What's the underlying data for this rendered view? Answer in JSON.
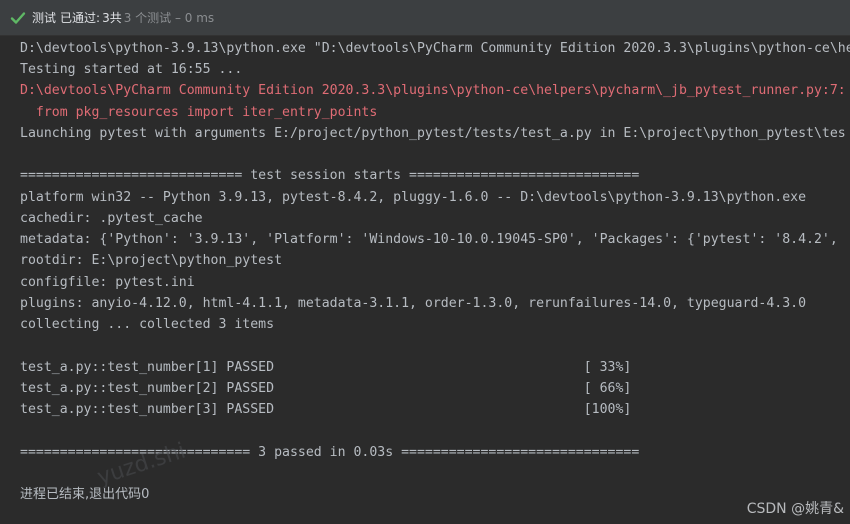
{
  "topbar": {
    "label": "测试",
    "passed_label": "已通过:",
    "count": "3共",
    "total": "3 个测试 – 0 ms",
    "accent": "#5fb865"
  },
  "console": {
    "lines": [
      "D:\\devtools\\python-3.9.13\\python.exe \"D:\\devtools\\PyCharm Community Edition 2020.3.3\\plugins\\python-ce\\he",
      "Testing started at 16:55 ...",
      "D:\\devtools\\PyCharm Community Edition 2020.3.3\\plugins\\python-ce\\helpers\\pycharm\\_jb_pytest_runner.py:7:",
      "  from pkg_resources import iter_entry_points",
      "Launching pytest with arguments E:/project/python_pytest/tests/test_a.py in E:\\project\\python_pytest\\tes",
      "============================ test session starts =============================",
      "platform win32 -- Python 3.9.13, pytest-8.4.2, pluggy-1.6.0 -- D:\\devtools\\python-3.9.13\\python.exe",
      "cachedir: .pytest_cache",
      "metadata: {'Python': '3.9.13', 'Platform': 'Windows-10-10.0.19045-SP0', 'Packages': {'pytest': '8.4.2',",
      "rootdir: E:\\project\\python_pytest",
      "configfile: pytest.ini",
      "plugins: anyio-4.12.0, html-4.1.1, metadata-3.1.1, order-1.3.0, rerunfailures-14.0, typeguard-4.3.0",
      "collecting ... collected 3 items",
      "test_a.py::test_number[1] PASSED                                       [ 33%]",
      "test_a.py::test_number[2] PASSED                                       [ 66%]",
      "test_a.py::test_number[3] PASSED                                       [100%]",
      "============================= 3 passed in 0.03s ==============================",
      "进程已结束,退出代码0"
    ]
  },
  "watermark": "CSDN @姚青&",
  "ghost_watermark": "yuzd.shi"
}
